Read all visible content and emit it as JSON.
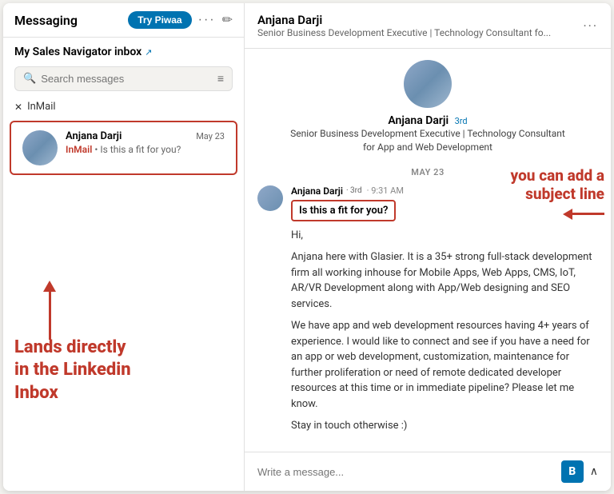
{
  "left": {
    "header": {
      "title": "Messaging",
      "try_btn": "Try Piwaa",
      "dots": "···",
      "compose_icon": "✏"
    },
    "inbox_title": "My Sales Navigator inbox",
    "external_icon": "↗",
    "search_placeholder": "Search messages",
    "filter_icon": "≡",
    "inmail_filter": "InMail",
    "close_icon": "✕",
    "message": {
      "name": "Anjana Darji",
      "date": "May 23",
      "tag": "InMail",
      "dot": "•",
      "preview": "Is this a fit for you?"
    }
  },
  "annotation_left": {
    "text": "Lands directly\nin the Linkedin\nInbox"
  },
  "right": {
    "header": {
      "name": "Anjana Darji",
      "subtitle": "Senior Business Development Executive | Technology Consultant fo...",
      "dots": "···"
    },
    "profile": {
      "name": "Anjana Darji",
      "degree": "3rd",
      "title": "Senior Business Development Executive | Technology Consultant for\nApp and Web Development"
    },
    "date_divider": "MAY 23",
    "message": {
      "sender": "Anjana Darji",
      "degree": "· 3rd",
      "time": "· 9:31 AM",
      "subject": "Is this a fit for you?",
      "body_1": "Hi,",
      "body_2": "Anjana here with Glasier. It is a 35+ strong full-stack development firm all working inhouse for Mobile Apps, Web Apps, CMS, IoT, AR/VR Development along with App/Web designing and SEO services.",
      "body_3": "We have app and web development resources having 4+ years of experience. I would like to connect and see if you have a need for an app or web development, customization, maintenance for further proliferation or need of remote dedicated developer resources at this time or in immediate pipeline? Please let me know.",
      "body_4": "Stay in touch otherwise :)"
    },
    "annotation": {
      "text": "you can add a\nsubject line"
    },
    "compose": {
      "placeholder": "Write a message...",
      "bold_btn": "B",
      "chevron": "∧"
    }
  }
}
